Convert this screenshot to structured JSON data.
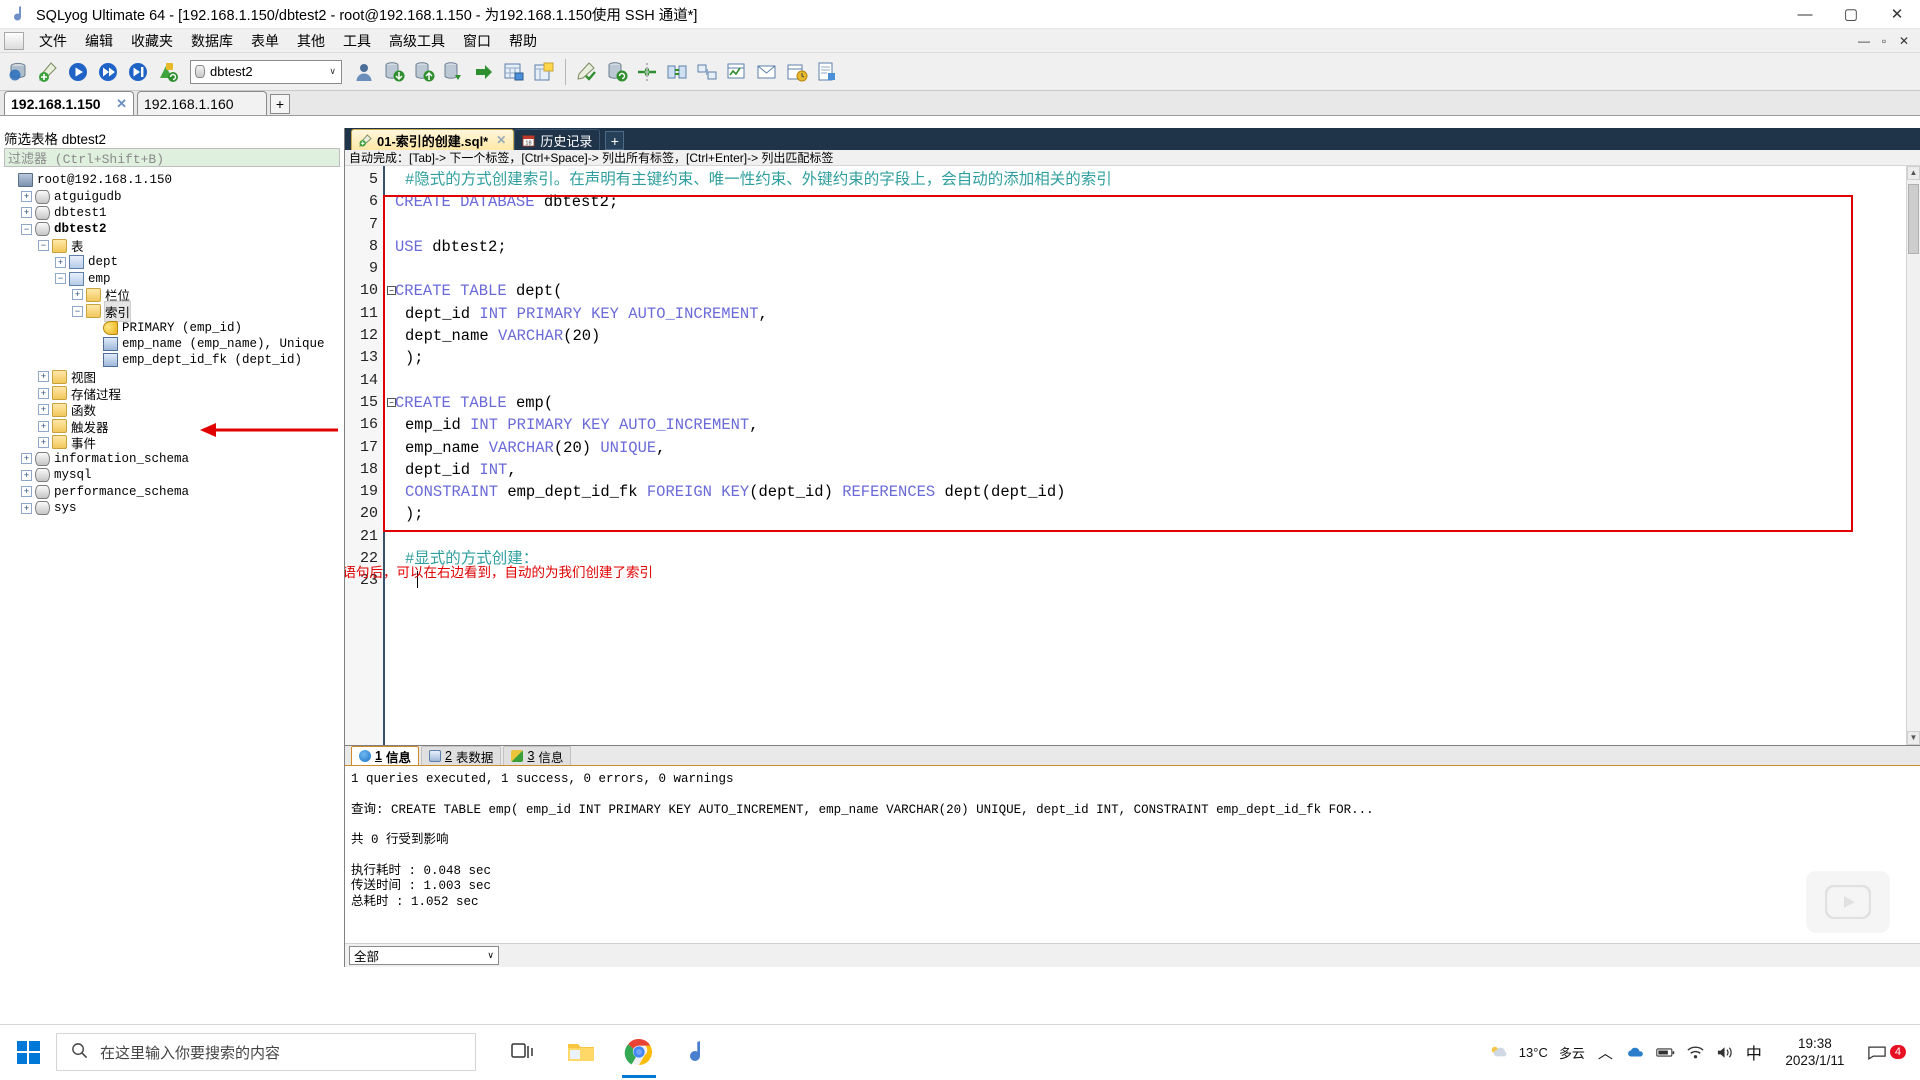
{
  "window": {
    "title": "SQLyog Ultimate 64 - [192.168.1.150/dbtest2 - root@192.168.1.150 - 为192.168.1.150使用 SSH 通道*]",
    "minimize": "—",
    "maximize": "▢",
    "close": "✕",
    "mdi_minimize": "—",
    "mdi_restore": "▫",
    "mdi_close": "✕"
  },
  "menu": {
    "items": [
      "文件",
      "编辑",
      "收藏夹",
      "数据库",
      "表单",
      "其他",
      "工具",
      "高级工具",
      "窗口",
      "帮助"
    ]
  },
  "toolbar": {
    "database_value": "dbtest2",
    "dropdown_arrow": "∨",
    "icons": [
      "new-connection-icon",
      "new-query-editor-icon",
      "execute-query-icon",
      "execute-all-queries-icon",
      "execute-current-query-icon",
      "refresh-object-browser-icon"
    ],
    "icons_right": [
      "user-manager-icon",
      "import-data-icon",
      "export-data-icon",
      "backup-database-icon",
      "restore-database-icon",
      "schema-designer-icon",
      "table-diagnostics-icon",
      "sql-formatter-icon",
      "database-sync-icon",
      "schema-sync-icon",
      "data-sync-icon",
      "query-builder-icon",
      "visual-data-compare-icon",
      "notification-services-icon",
      "scheduled-backup-icon",
      "html-report-icon"
    ]
  },
  "connection_tabs": {
    "tabs": [
      {
        "label": "192.168.1.150",
        "close": "✕",
        "active": true
      },
      {
        "label": "192.168.1.160",
        "close": "",
        "active": false
      }
    ],
    "add_label": "+"
  },
  "object_browser": {
    "header": "筛选表格  dbtest2",
    "filter_placeholder": "过滤器 (Ctrl+Shift+B)",
    "tree": [
      {
        "indent": 0,
        "exp": "",
        "icon": "server-icon",
        "label": "root@192.168.1.150",
        "bold": false,
        "selected": false
      },
      {
        "indent": 1,
        "exp": "+",
        "icon": "database-icon",
        "label": "atguigudb",
        "bold": false,
        "selected": false
      },
      {
        "indent": 1,
        "exp": "+",
        "icon": "database-icon",
        "label": "dbtest1",
        "bold": false,
        "selected": false
      },
      {
        "indent": 1,
        "exp": "−",
        "icon": "database-icon",
        "label": "dbtest2",
        "bold": true,
        "selected": false
      },
      {
        "indent": 2,
        "exp": "−",
        "icon": "folder-icon",
        "label": "表",
        "bold": false,
        "selected": false
      },
      {
        "indent": 3,
        "exp": "+",
        "icon": "table-icon",
        "label": "dept",
        "bold": false,
        "selected": false
      },
      {
        "indent": 3,
        "exp": "−",
        "icon": "table-icon",
        "label": "emp",
        "bold": false,
        "selected": false
      },
      {
        "indent": 4,
        "exp": "+",
        "icon": "folder-icon",
        "label": "栏位",
        "bold": false,
        "selected": false
      },
      {
        "indent": 4,
        "exp": "−",
        "icon": "folder-icon",
        "label": "索引",
        "bold": false,
        "selected": true
      },
      {
        "indent": 5,
        "exp": "",
        "icon": "key-icon",
        "label": "PRIMARY (emp_id)",
        "bold": false,
        "selected": false
      },
      {
        "indent": 5,
        "exp": "",
        "icon": "index-icon",
        "label": "emp_name (emp_name), Unique",
        "bold": false,
        "selected": false
      },
      {
        "indent": 5,
        "exp": "",
        "icon": "index-icon",
        "label": "emp_dept_id_fk (dept_id)",
        "bold": false,
        "selected": false
      },
      {
        "indent": 2,
        "exp": "+",
        "icon": "folder-icon",
        "label": "视图",
        "bold": false,
        "selected": false
      },
      {
        "indent": 2,
        "exp": "+",
        "icon": "folder-icon",
        "label": "存储过程",
        "bold": false,
        "selected": false
      },
      {
        "indent": 2,
        "exp": "+",
        "icon": "folder-icon",
        "label": "函数",
        "bold": false,
        "selected": false
      },
      {
        "indent": 2,
        "exp": "+",
        "icon": "folder-icon",
        "label": "触发器",
        "bold": false,
        "selected": false
      },
      {
        "indent": 2,
        "exp": "+",
        "icon": "folder-icon",
        "label": "事件",
        "bold": false,
        "selected": false
      },
      {
        "indent": 1,
        "exp": "+",
        "icon": "database-icon",
        "label": "information_schema",
        "bold": false,
        "selected": false
      },
      {
        "indent": 1,
        "exp": "+",
        "icon": "database-icon",
        "label": "mysql",
        "bold": false,
        "selected": false
      },
      {
        "indent": 1,
        "exp": "+",
        "icon": "database-icon",
        "label": "performance_schema",
        "bold": false,
        "selected": false
      },
      {
        "indent": 1,
        "exp": "+",
        "icon": "database-icon",
        "label": "sys",
        "bold": false,
        "selected": false
      }
    ]
  },
  "editor": {
    "tabs": [
      {
        "label": "01-索引的创建.sql*",
        "close": "✕",
        "active": true,
        "icon": "sql-file-icon"
      },
      {
        "label": "历史记录",
        "close": "",
        "active": false,
        "icon": "calendar-icon"
      }
    ],
    "add_label": "+",
    "hint": "自动完成：[Tab]-> 下一个标签，[Ctrl+Space]-> 列出所有标签，[Ctrl+Enter]-> 列出匹配标签",
    "line_numbers": [
      "5",
      "6",
      "7",
      "8",
      "9",
      "10",
      "11",
      "12",
      "13",
      "14",
      "15",
      "16",
      "17",
      "18",
      "19",
      "20",
      "21",
      "22",
      "23"
    ],
    "lines": [
      {
        "n": "5",
        "text": "#隐式的方式创建索引。在声明有主键约束、唯一性约束、外键约束的字段上，会自动的添加相关的索引",
        "style": "comment",
        "fold": ""
      },
      {
        "n": "6",
        "text": "CREATE DATABASE dbtest2;",
        "style": "sql",
        "fold": ""
      },
      {
        "n": "7",
        "text": "",
        "style": "sql",
        "fold": ""
      },
      {
        "n": "8",
        "text": "USE dbtest2;",
        "style": "sql",
        "fold": ""
      },
      {
        "n": "9",
        "text": "",
        "style": "sql",
        "fold": ""
      },
      {
        "n": "10",
        "text": "CREATE TABLE dept(",
        "style": "sql",
        "fold": "−"
      },
      {
        "n": "11",
        "text": "dept_id INT PRIMARY KEY AUTO_INCREMENT,",
        "style": "sql",
        "fold": ""
      },
      {
        "n": "12",
        "text": "dept_name VARCHAR(20)",
        "style": "sql",
        "fold": ""
      },
      {
        "n": "13",
        "text": ");",
        "style": "sql",
        "fold": ""
      },
      {
        "n": "14",
        "text": "",
        "style": "sql",
        "fold": ""
      },
      {
        "n": "15",
        "text": "CREATE TABLE emp(",
        "style": "sql",
        "fold": "−"
      },
      {
        "n": "16",
        "text": "emp_id INT PRIMARY KEY AUTO_INCREMENT,",
        "style": "sql",
        "fold": ""
      },
      {
        "n": "17",
        "text": "emp_name VARCHAR(20) UNIQUE,",
        "style": "sql",
        "fold": ""
      },
      {
        "n": "18",
        "text": "dept_id INT,",
        "style": "sql",
        "fold": ""
      },
      {
        "n": "19",
        "text": "CONSTRAINT emp_dept_id_fk FOREIGN KEY(dept_id) REFERENCES dept(dept_id)",
        "style": "sql",
        "fold": ""
      },
      {
        "n": "20",
        "text": ");",
        "style": "sql",
        "fold": ""
      },
      {
        "n": "21",
        "text": "",
        "style": "sql",
        "fold": ""
      },
      {
        "n": "22",
        "text": "#显式的方式创建：",
        "style": "comment",
        "fold": ""
      },
      {
        "n": "23",
        "text": "",
        "style": "sql",
        "fold": ""
      }
    ],
    "annotation": "执行完这些语句后，可以在右边看到，自动的为我们创建了索引",
    "annotation_color": "#e00000"
  },
  "results": {
    "tabs": [
      {
        "num": "1",
        "label": "信息",
        "icon": "info-icon",
        "color": "#1a73c8",
        "active": true
      },
      {
        "num": "2",
        "label": "表数据",
        "icon": "grid-icon",
        "color": "#7aa3d0",
        "active": false
      },
      {
        "num": "3",
        "label": "信息",
        "icon": "chart-icon",
        "color": "#d8b93a",
        "active": false
      }
    ],
    "lines": [
      "1 queries executed, 1 success, 0 errors, 0 warnings",
      "",
      "查询: CREATE TABLE emp( emp_id INT PRIMARY KEY AUTO_INCREMENT, emp_name VARCHAR(20) UNIQUE, dept_id INT, CONSTRAINT emp_dept_id_fk FOR...",
      "",
      "共 0 行受到影响",
      "",
      "执行耗时    : 0.048 sec",
      "传送时间    : 1.003 sec",
      "总耗时      : 1.052 sec"
    ],
    "footer_select": "全部",
    "footer_arrow": "∨"
  },
  "taskbar": {
    "search_placeholder": "在这里输入你要搜索的内容",
    "apps": [
      {
        "name": "task-view-icon"
      },
      {
        "name": "file-explorer-icon"
      },
      {
        "name": "chrome-icon"
      },
      {
        "name": "sqlyog-icon"
      }
    ],
    "weather_temp": "13°C",
    "weather_desc": "多云",
    "time": "19:38",
    "date": "2023/1/11",
    "ime": "中",
    "tray_count": "4"
  }
}
